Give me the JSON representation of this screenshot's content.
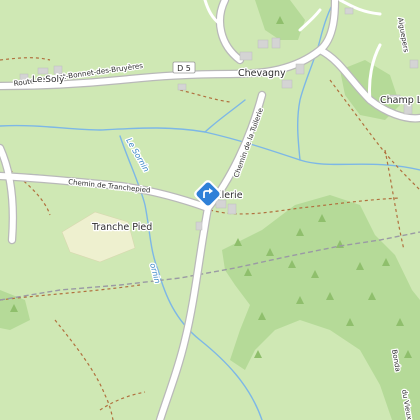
{
  "map": {
    "place_labels": {
      "le_soly": "Le Soly",
      "chevagny": "Chevagny",
      "champ": "Champ L",
      "tranche_pied": "Tranche Pied",
      "tuilerie": "uilerie"
    },
    "road_labels": {
      "route_st_bonnet": "Route de Saint-Bonnet-des-Bruyères",
      "chemin_tranchepied": "Chemin de Tranchepied",
      "chemin_tuilerie": "Chemin de la Tuilerie",
      "d5": "D 5",
      "aigueperse": "Aiguepers",
      "bonda": "Bonda",
      "vieux": "du Vieux"
    },
    "water_labels": {
      "le_sornin": "Le Sornin",
      "sornin": "ornin"
    },
    "marker_icon": "direction-sign-icon",
    "colors": {
      "grass": "#cfe8b4",
      "forest": "#b2d894",
      "water": "#7db7e6",
      "road": "#ffffff",
      "road_casing": "#b8b8b8",
      "path": "#b06a3a",
      "marker": "#2f80d8"
    }
  }
}
